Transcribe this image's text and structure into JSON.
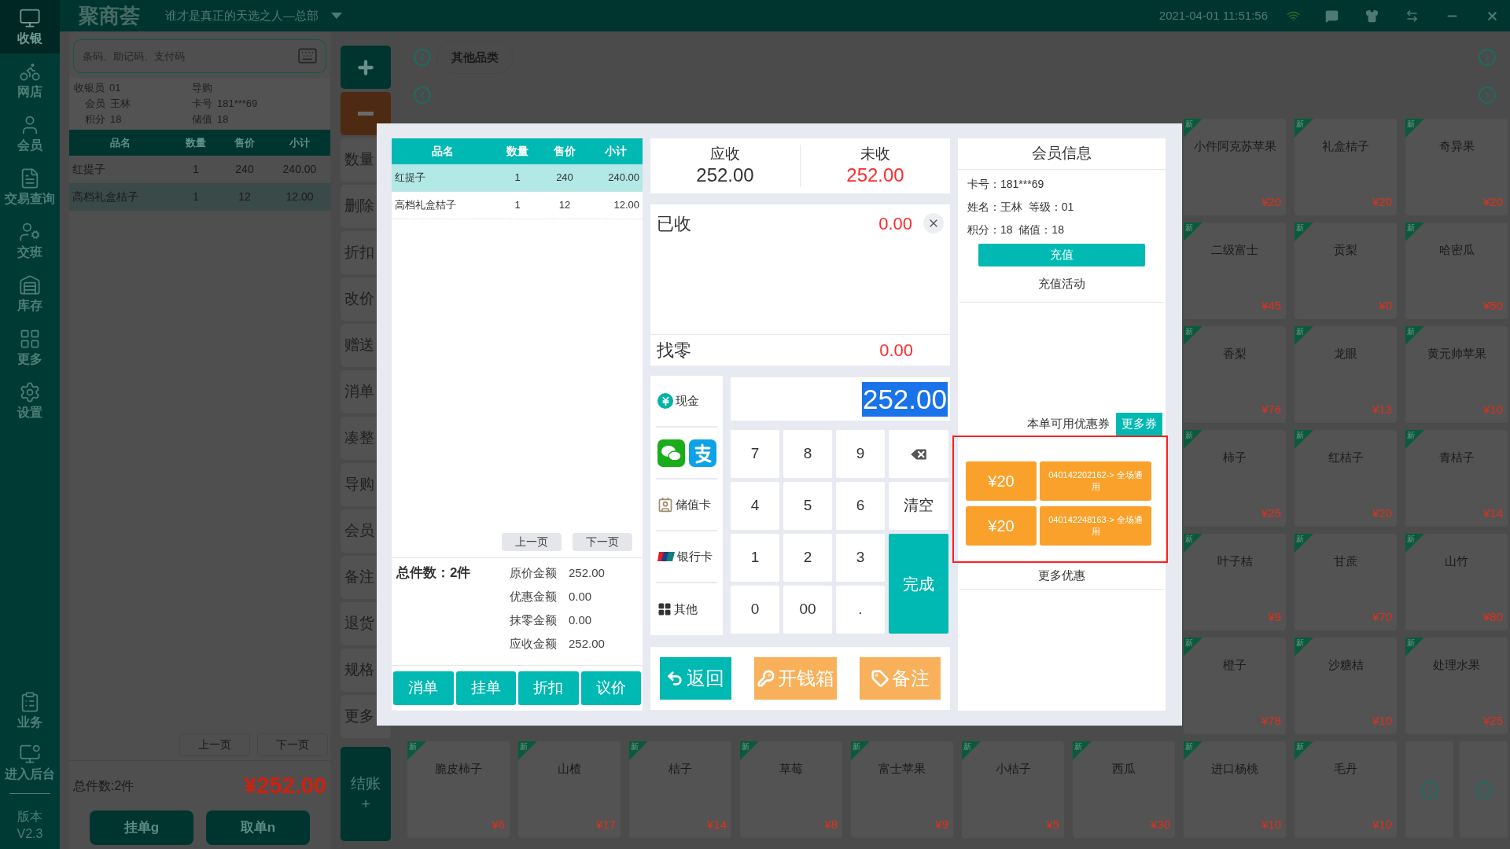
{
  "topbar": {
    "logo": "聚商荟",
    "store": "谁才是真正的天选之人—总部",
    "datetime": "2021-04-01 11:51:56"
  },
  "sidebar": {
    "items": [
      {
        "label": "收银",
        "selected": true
      },
      {
        "label": "网店",
        "selected": false
      },
      {
        "label": "会员",
        "selected": false
      },
      {
        "label": "交易查询",
        "selected": false
      },
      {
        "label": "交班",
        "selected": false
      },
      {
        "label": "库存",
        "selected": false
      },
      {
        "label": "更多",
        "selected": false
      },
      {
        "label": "设置",
        "selected": false
      }
    ],
    "bottom_items": [
      {
        "label": "业务"
      },
      {
        "label": "进入后台"
      }
    ],
    "version_label": "版本",
    "version": "V2.3"
  },
  "cart": {
    "search": {
      "placeholder": "条码、助记码、支付码"
    },
    "info": [
      {
        "label": "收银员",
        "value": "01"
      },
      {
        "label": "导购"
      },
      {
        "label": "会员",
        "value": "王林"
      },
      {
        "label": "卡号",
        "value": "181***69"
      },
      {
        "label": "积分",
        "value": "18"
      },
      {
        "label": "储值",
        "value": "18"
      }
    ],
    "columns": [
      "品名",
      "数量",
      "售价",
      "小计"
    ],
    "rows": [
      {
        "cells": [
          "红提子",
          "1",
          "240",
          "240.00"
        ],
        "selected": false
      },
      {
        "cells": [
          "高档礼盒桔子",
          "1",
          "12",
          "12.00"
        ],
        "selected": true
      }
    ],
    "pager": [
      "上一页",
      "下一页"
    ],
    "total_count": "总件数:2件",
    "total": "¥252.00",
    "buttons": [
      "挂单g",
      "取单n"
    ]
  },
  "actions": {
    "buttons": [
      "数量",
      "删除",
      "折扣",
      "改价",
      "赠送",
      "消单",
      "凑整",
      "导购",
      "会员",
      "备注",
      "退货",
      "规格",
      "更多"
    ],
    "checkout": {
      "label": "结账",
      "sub": "+"
    }
  },
  "category": "其他品类",
  "product_rows": [
    {
      "items": [
        {
          "badge": "新",
          "name": "小件阿克苏苹果",
          "price": "¥20"
        },
        {
          "badge": "新",
          "name": "礼盒桔子",
          "price": "¥20"
        },
        {
          "badge": "新",
          "name": "奇异果",
          "price": "¥20"
        }
      ]
    },
    {
      "items": [
        {
          "badge": "新",
          "name": "二级富士",
          "price": "¥45"
        },
        {
          "badge": "新",
          "name": "贡梨",
          "price": "¥0"
        },
        {
          "badge": "新",
          "name": "哈密瓜",
          "price": "¥50"
        }
      ]
    },
    {
      "items": [
        {
          "badge": "新",
          "name": "香梨",
          "price": "¥76"
        },
        {
          "badge": "新",
          "name": "龙眼",
          "price": "¥13"
        },
        {
          "badge": "新",
          "name": "黄元帅苹果",
          "price": "¥10"
        }
      ]
    },
    {
      "items": [
        {
          "badge": "新",
          "name": "柿子",
          "price": "¥25"
        },
        {
          "badge": "新",
          "name": "红桔子",
          "price": "¥20"
        },
        {
          "badge": "新",
          "name": "青桔子",
          "price": "¥14"
        }
      ]
    },
    {
      "items": [
        {
          "badge": "新",
          "name": "叶子桔",
          "price": "¥9"
        },
        {
          "badge": "新",
          "name": "甘蔗",
          "price": "¥70"
        },
        {
          "badge": "新",
          "name": "山竹",
          "price": "¥80"
        }
      ]
    },
    {
      "items": [
        {
          "badge": "新",
          "name": "橙子",
          "price": "¥78"
        },
        {
          "badge": "新",
          "name": "沙糖桔",
          "price": "¥10"
        },
        {
          "badge": "新",
          "name": "处理水果",
          "price": "¥25"
        }
      ]
    },
    {
      "pager": true,
      "items": [
        {
          "badge": "新",
          "name": "脆皮柿子",
          "price": "¥6"
        },
        {
          "badge": "新",
          "name": "山楂",
          "price": "¥17"
        },
        {
          "badge": "新",
          "name": "桔子",
          "price": "¥14"
        },
        {
          "badge": "新",
          "name": "草莓",
          "price": "¥8"
        },
        {
          "badge": "新",
          "name": "富士苹果",
          "price": "¥9"
        },
        {
          "badge": "新",
          "name": "小桔子",
          "price": "¥5"
        },
        {
          "badge": "新",
          "name": "西瓜",
          "price": "¥30"
        },
        {
          "badge": "新",
          "name": "进口杨桃",
          "price": "¥10"
        },
        {
          "badge": "新",
          "name": "毛丹",
          "price": "¥10"
        }
      ]
    }
  ],
  "checkout_dialog": {
    "items_table": {
      "columns": [
        "品名",
        "数量",
        "售价",
        "小计"
      ],
      "rows": [
        {
          "cells": [
            "红提子",
            "1",
            "240",
            "240.00"
          ],
          "selected": true
        },
        {
          "cells": [
            "高档礼盒桔子",
            "1",
            "12",
            "12.00"
          ],
          "selected": false
        }
      ],
      "pager": [
        "上一页",
        "下一页"
      ]
    },
    "summary": {
      "count": "总件数：2件",
      "lines": [
        {
          "label": "原价金额",
          "value": "252.00"
        },
        {
          "label": "优惠金额",
          "value": "0.00"
        },
        {
          "label": "抹零金额",
          "value": "0.00"
        },
        {
          "label": "应收金额",
          "value": "252.00"
        }
      ]
    },
    "actions": [
      "消单",
      "挂单",
      "折扣",
      "议价"
    ],
    "due": {
      "label": "应收",
      "value": "252.00"
    },
    "unpaid": {
      "label": "未收",
      "value": "252.00"
    },
    "received": {
      "label": "已收",
      "value": "0.00"
    },
    "change": {
      "label": "找零",
      "value": "0.00"
    },
    "methods": [
      {
        "kind": "cash",
        "label": "现金"
      },
      {
        "kind": "wallet"
      },
      {
        "kind": "stored",
        "label": "储值卡"
      },
      {
        "kind": "bank",
        "label": "银行卡"
      },
      {
        "kind": "other",
        "label": "其他"
      }
    ],
    "amount": "252.00",
    "keys": [
      {
        "label": "7"
      },
      {
        "label": "8"
      },
      {
        "label": "9"
      },
      {
        "kind": "backspace"
      },
      {
        "label": "4"
      },
      {
        "label": "5"
      },
      {
        "label": "6"
      },
      {
        "label": "清空"
      },
      {
        "label": "1"
      },
      {
        "label": "2"
      },
      {
        "label": "3"
      },
      {
        "kind": "confirm",
        "label": "完成"
      },
      {
        "label": "0"
      },
      {
        "label": "00"
      },
      {
        "label": "."
      }
    ],
    "footer_buttons": [
      {
        "kind": "back",
        "label": "返回"
      },
      {
        "kind": "drawer",
        "label": "开钱箱"
      },
      {
        "kind": "note",
        "label": "备注"
      }
    ],
    "member": {
      "title": "会员信息",
      "lines": [
        "卡号：181***69",
        "姓名：王林  等级：01",
        "积分：18  储值：18"
      ],
      "recharge": "充值",
      "activity": "充值活动",
      "coupon_label": "本单可用优惠券",
      "more_coupons": "更多券",
      "coupons": [
        {
          "amount": "¥20",
          "code": "040142202162-> 全场通用"
        },
        {
          "amount": "¥20",
          "code": "040142248163-> 全场通用"
        }
      ],
      "more_offers": "更多优惠"
    }
  }
}
